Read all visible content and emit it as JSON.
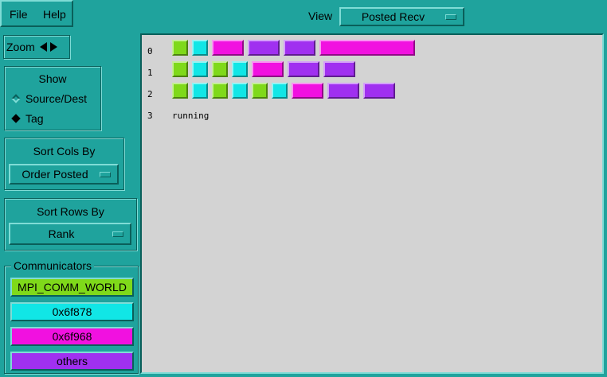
{
  "menu": {
    "file": "File",
    "help": "Help"
  },
  "view": {
    "label": "View",
    "selected": "Posted Recv"
  },
  "zoom": {
    "label": "Zoom"
  },
  "show": {
    "title": "Show",
    "options": [
      "Source/Dest",
      "Tag"
    ],
    "selected": "Tag"
  },
  "sort_cols": {
    "title": "Sort Cols By",
    "selected": "Order Posted"
  },
  "sort_rows": {
    "title": "Sort Rows By",
    "selected": "Rank"
  },
  "communicators": {
    "title": "Communicators",
    "items": [
      {
        "label": "MPI_COMM_WORLD",
        "color": "#7fd91a"
      },
      {
        "label": "0x6f878",
        "color": "#11e6e6"
      },
      {
        "label": "0x6f968",
        "color": "#f111e0"
      },
      {
        "label": "others",
        "color": "#a030f0"
      }
    ]
  },
  "rows": [
    {
      "label": "0",
      "cells": [
        "MPI_COMM_WORLD",
        "0x6f878",
        "0x6f968",
        "others",
        "others",
        "0x6f968"
      ]
    },
    {
      "label": "1",
      "cells": [
        "MPI_COMM_WORLD",
        "0x6f878",
        "MPI_COMM_WORLD",
        "0x6f878",
        "0x6f968",
        "others",
        "others"
      ]
    },
    {
      "label": "2",
      "cells": [
        "MPI_COMM_WORLD",
        "0x6f878",
        "MPI_COMM_WORLD",
        "0x6f878",
        "MPI_COMM_WORLD",
        "0x6f878",
        "0x6f968",
        "others",
        "others"
      ]
    },
    {
      "label": "3",
      "cells": [],
      "status": "running"
    }
  ]
}
